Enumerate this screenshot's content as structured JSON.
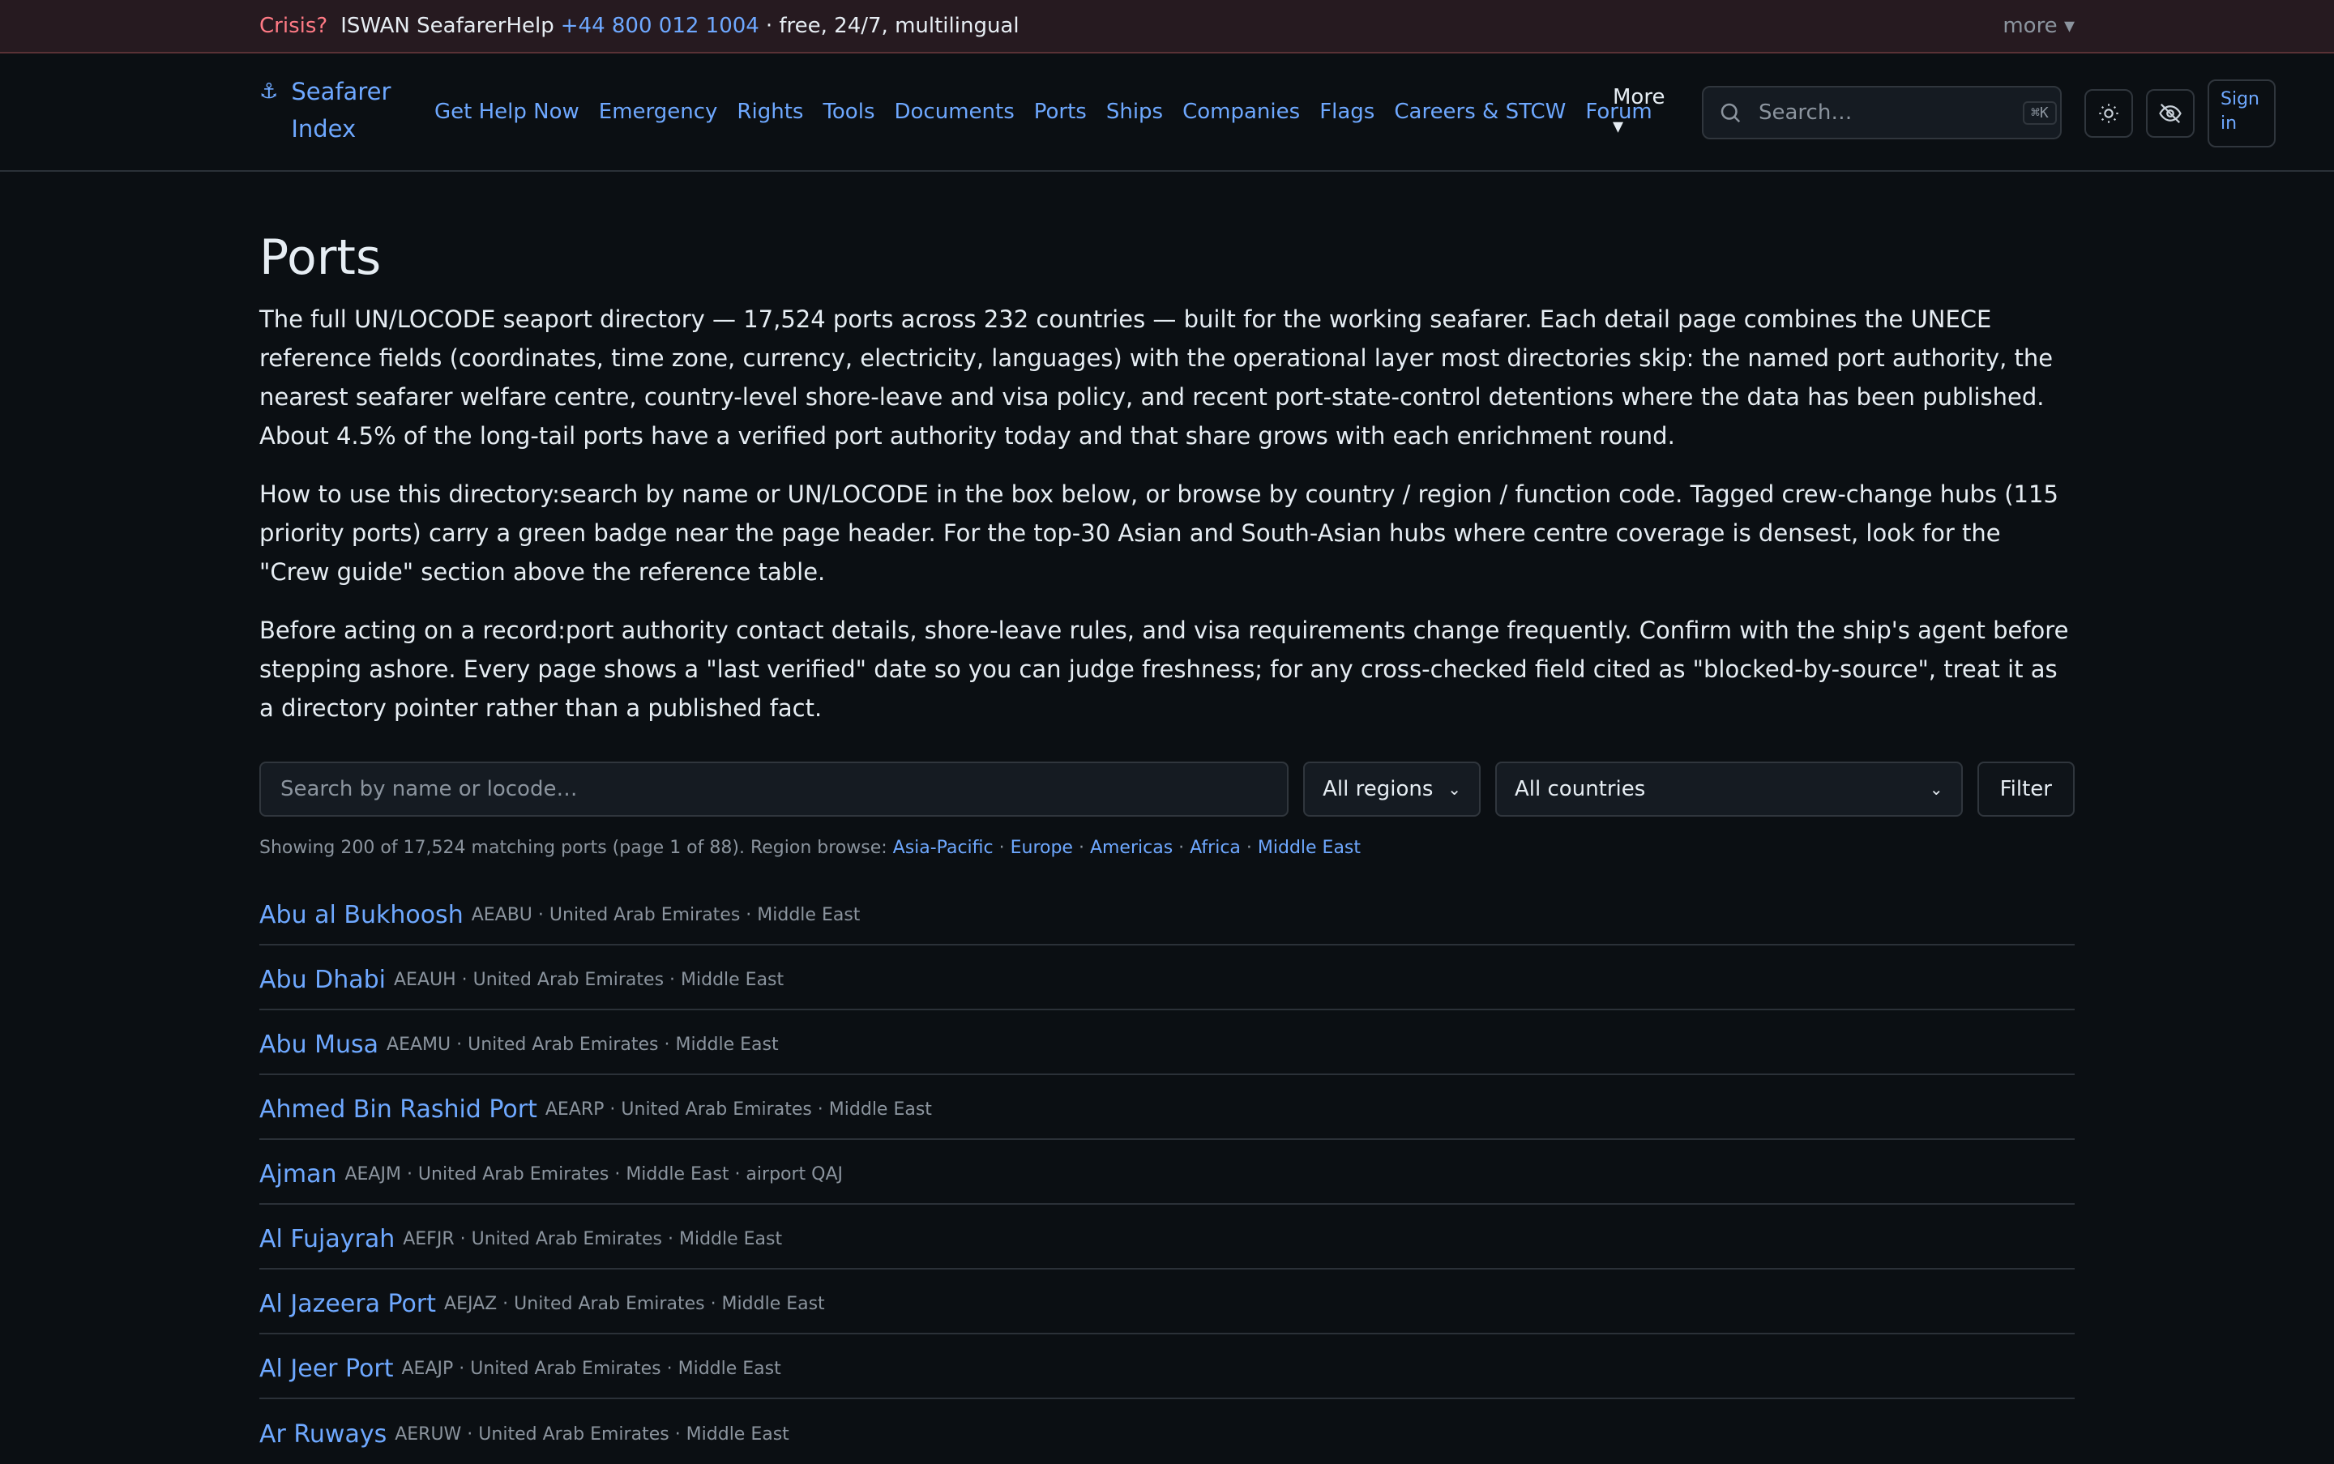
{
  "crisis": {
    "label": "Crisis?",
    "org": "ISWAN SeafarerHelp",
    "phone": "+44 800 012 1004",
    "rest": "· free, 24/7, multilingual",
    "more": "more ▾"
  },
  "nav": {
    "brand_icon": "⚓",
    "brand": "Seafarer Index",
    "links": [
      "Get Help Now",
      "Emergency",
      "Rights",
      "Tools",
      "Documents",
      "Ports",
      "Ships",
      "Companies",
      "Flags",
      "Careers & STCW",
      "Forum"
    ],
    "more": "More ▾",
    "search_placeholder": "Search…",
    "search_kbd": "⌘K",
    "signin": "Sign in",
    "icons": {
      "theme": "sun-icon",
      "privacy": "eye-off-icon",
      "search": "search-icon"
    }
  },
  "page": {
    "title": "Ports",
    "intro": "The full UN/LOCODE seaport directory — 17,524 ports across 232 countries — built for the working seafarer. Each detail page combines the UNECE reference fields (coordinates, time zone, currency, electricity, languages) with the operational layer most directories skip: the named port authority, the nearest seafarer welfare centre, country-level shore-leave and visa policy, and recent port-state-control detentions where the data has been published. About 4.5% of the long-tail ports have a verified port authority today and that share grows with each enrichment round.",
    "howto_label": "How to use this directory:",
    "howto": "search by name or UN/LOCODE in the box below, or browse by country / region / function code. Tagged crew-change hubs (115 priority ports) carry a green badge near the page header. For the top-30 Asian and South-Asian hubs where centre coverage is densest, look for the \"Crew guide\" section above the reference table.",
    "before_label": "Before acting on a record:",
    "before": "port authority contact details, shore-leave rules, and visa requirements change frequently. Confirm with the ship's agent before stepping ashore. Every page shows a \"last verified\" date so you can judge freshness; for any cross-checked field cited as \"blocked-by-source\", treat it as a directory pointer rather than a published fact."
  },
  "filters": {
    "search_placeholder": "Search by name or locode…",
    "region": "All regions",
    "country": "All countries",
    "button": "Filter"
  },
  "status": {
    "text": "Showing 200 of 17,524 matching ports (page 1 of 88). Region browse: ",
    "regions": [
      "Asia-Pacific",
      "Europe",
      "Americas",
      "Africa",
      "Middle East"
    ]
  },
  "ports": [
    {
      "name": "Abu al Bukhoosh",
      "meta": "AEABU · United Arab Emirates · Middle East"
    },
    {
      "name": "Abu Dhabi",
      "meta": "AEAUH · United Arab Emirates · Middle East"
    },
    {
      "name": "Abu Musa",
      "meta": "AEAMU · United Arab Emirates · Middle East"
    },
    {
      "name": "Ahmed Bin Rashid Port",
      "meta": "AEARP · United Arab Emirates · Middle East"
    },
    {
      "name": "Ajman",
      "meta": "AEAJM · United Arab Emirates · Middle East · airport QAJ"
    },
    {
      "name": "Al Fujayrah",
      "meta": "AEFJR · United Arab Emirates · Middle East"
    },
    {
      "name": "Al Jazeera Port",
      "meta": "AEJAZ · United Arab Emirates · Middle East"
    },
    {
      "name": "Al Jeer Port",
      "meta": "AEAJP · United Arab Emirates · Middle East"
    },
    {
      "name": "Ar Ruways",
      "meta": "AERUW · United Arab Emirates · Middle East"
    }
  ]
}
